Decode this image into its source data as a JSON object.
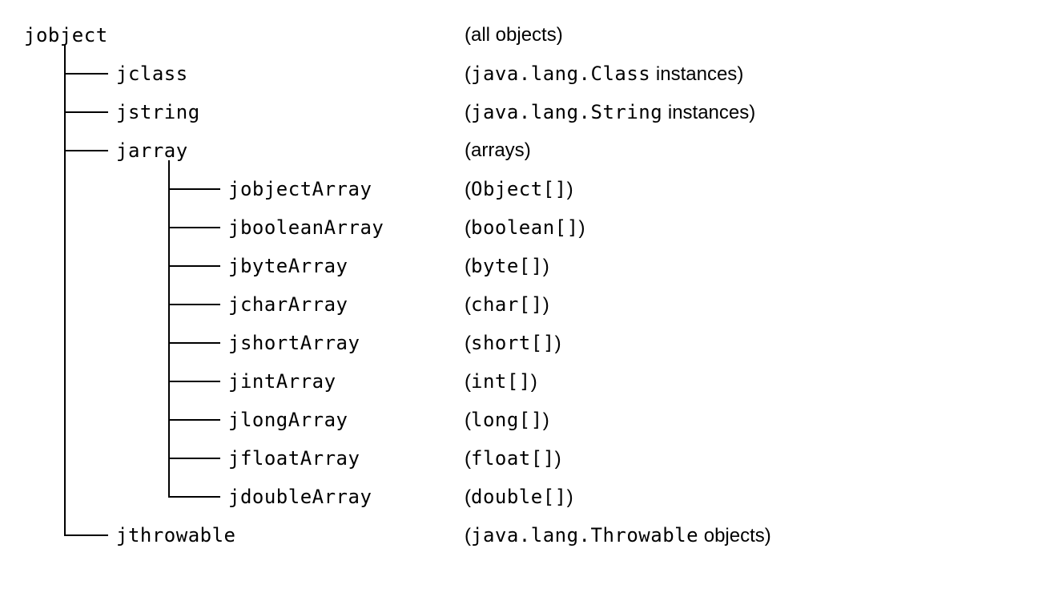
{
  "root": {
    "name": "jobject",
    "desc_prefix": "(",
    "desc_plain": "all objects",
    "desc_suffix": ")"
  },
  "level1": [
    {
      "name": "jclass",
      "desc_prefix": "(",
      "desc_mono": "java.lang.Class",
      "desc_plain": " instances",
      "desc_suffix": ")"
    },
    {
      "name": "jstring",
      "desc_prefix": "(",
      "desc_mono": "java.lang.String",
      "desc_plain": " instances",
      "desc_suffix": ")"
    },
    {
      "name": "jarray",
      "desc_prefix": "(",
      "desc_mono": "",
      "desc_plain": "arrays",
      "desc_suffix": ")"
    },
    {
      "name": "jthrowable",
      "desc_prefix": "(",
      "desc_mono": "java.lang.Throwable",
      "desc_plain": " objects",
      "desc_suffix": ")"
    }
  ],
  "jarray_children": [
    {
      "name": "jobjectArray",
      "desc_prefix": "(",
      "desc_mono": "Object[]",
      "desc_suffix": ")"
    },
    {
      "name": "jbooleanArray",
      "desc_prefix": "(",
      "desc_mono": "boolean[]",
      "desc_suffix": ")"
    },
    {
      "name": "jbyteArray",
      "desc_prefix": "(",
      "desc_mono": "byte[]",
      "desc_suffix": ")"
    },
    {
      "name": "jcharArray",
      "desc_prefix": "(",
      "desc_mono": "char[]",
      "desc_suffix": ")"
    },
    {
      "name": "jshortArray",
      "desc_prefix": "(",
      "desc_mono": "short[]",
      "desc_suffix": ")"
    },
    {
      "name": "jintArray",
      "desc_prefix": "(",
      "desc_mono": "int[]",
      "desc_suffix": ")"
    },
    {
      "name": "jlongArray",
      "desc_prefix": "(",
      "desc_mono": "long[]",
      "desc_suffix": ")"
    },
    {
      "name": "jfloatArray",
      "desc_prefix": "(",
      "desc_mono": "float[]",
      "desc_suffix": ")"
    },
    {
      "name": "jdoubleArray",
      "desc_prefix": "(",
      "desc_mono": "double[]",
      "desc_suffix": ")"
    }
  ]
}
